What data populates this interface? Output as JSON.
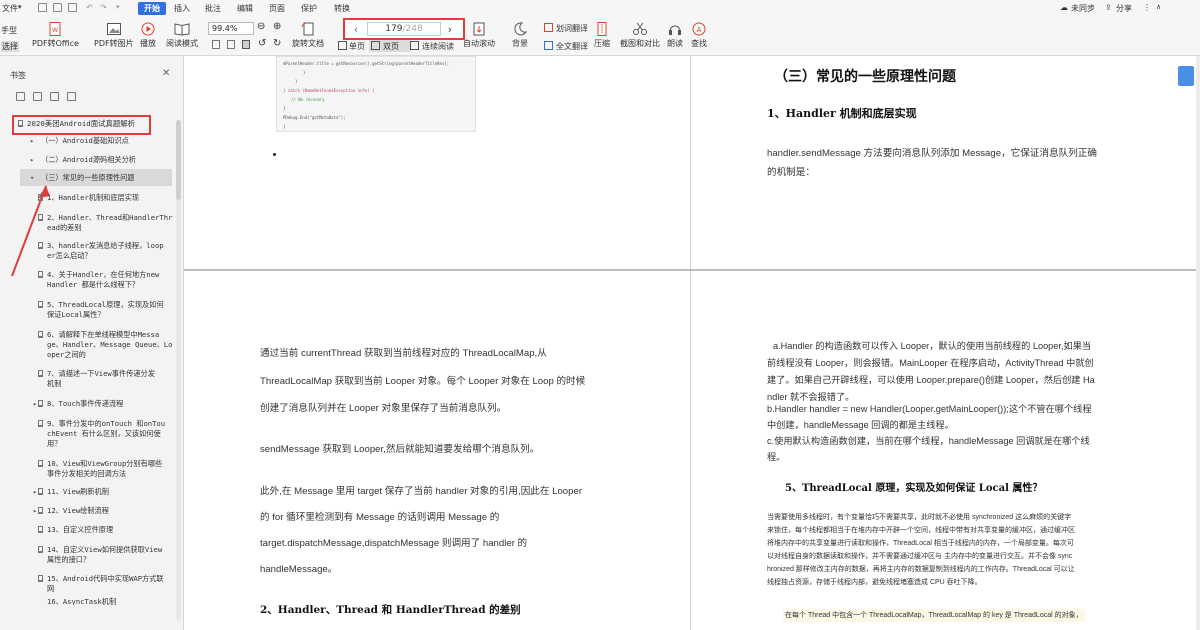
{
  "menu": {
    "file": "文件",
    "start": "开始",
    "tabs": [
      "插入",
      "批注",
      "编辑",
      "页面",
      "保护",
      "转换"
    ],
    "sync": "未同步",
    "share": "分享"
  },
  "left_tools": {
    "hand": "手型",
    "select": "选择"
  },
  "toolbar": {
    "pdf_to_office": "PDF转Office",
    "pdf_to_image": "PDF转图片",
    "play": "播放",
    "read_mode": "阅读模式",
    "zoom": "99.4%",
    "rotate_doc": "旋转文档",
    "single_page": "单页",
    "double_page": "双页",
    "continuous": "连续阅读",
    "auto_scroll": "自动滚动",
    "background": "背景",
    "word_translate": "划词翻译",
    "full_translate": "全文翻译",
    "compress": "压缩",
    "screenshot_compare": "截图和对比",
    "read_aloud": "朗读",
    "search": "查找"
  },
  "page_nav": {
    "current": "179",
    "total": "/248"
  },
  "sidebar": {
    "title": "书签",
    "root": "2020美团Android面试真题解析",
    "items": [
      {
        "label": "（一）Android基础知识点"
      },
      {
        "label": "（二）Android源码相关分析"
      },
      {
        "label": "（三）常见的一些原理性问题"
      },
      {
        "label": "1、Handler机制和底层实现"
      },
      {
        "label": "2、Handler、Thread和HandlerThr",
        "label2": "ead的差别"
      },
      {
        "label": "3、handler发消息给子线程，loop",
        "label2": "er怎么启动？"
      },
      {
        "label": "4、关于Handler，在任何地方new",
        "label2": "Handler 都是什么线程下？"
      },
      {
        "label": "5、ThreadLocal原理，实现及如何",
        "label2": "保证Local属性？"
      },
      {
        "label": "6、请解释下在单线程模型中Messa",
        "label2": "ge、Handler、Message Queue、Lo",
        "label3": "oper之间的"
      },
      {
        "label": "7、请描述一下View事件传递分发",
        "label2": "机制"
      },
      {
        "label": "8、Touch事件传递流程"
      },
      {
        "label": "9、事件分发中的onTouch 和onTou",
        "label2": "chEvent 有什么区别，又该如何使",
        "label3": "用？"
      },
      {
        "label": "10、View和ViewGroup分别有哪些",
        "label2": "事件分发相关的回调方法"
      },
      {
        "label": "11、View刷新机制"
      },
      {
        "label": "12、View绘制流程"
      },
      {
        "label": "13、自定义控件原理"
      },
      {
        "label": "14、自定义View如何提供获取View",
        "label2": "属性的接口？"
      },
      {
        "label": "15、Android代码中实现WAP方式联",
        "label2": "网"
      },
      {
        "label": "16、AsyncTask机制"
      }
    ]
  },
  "page_top_left": {
    "code_lines": [
      "mParentHeader.title = getResources().getString(parentHeaderTitleRes);",
      "}",
      "}",
      "} catch (NameNotFoundException nnfe) {",
      "// No recovery",
      "}",
      "PDebug.End(\"getMetaData\");",
      "}"
    ]
  },
  "page_top_right": {
    "heading": "（三）常见的一些原理性问题",
    "subheading": "1、Handler 机制和底层实现",
    "para1": "handler.sendMessage 方法要向消息队列添加 Message，它保证消息队列正确",
    "para2": "的机制是："
  },
  "page_bottom_left": {
    "lines": [
      "通过当前 currentThread 获取到当前线程对应的 ThreadLocalMap,从",
      "ThreadLocalMap 获取到当前 Looper 对象。每个 Looper 对象在 Loop 的时候",
      "创建了消息队列并在 Looper 对象里保存了当前消息队列。",
      "sendMessage 获取到 Looper,然后就能知道要发给哪个消息队列。",
      "此外,在 Message 里用  target 保存了当前 handler 对象的引用,因此在 Looper",
      "的 for 循环里检测到有 Message 的话则调用 Message 的",
      "target.dispatchMessage,dispatchMessage 则调用了 handler 的",
      "handleMessage。"
    ],
    "heading": "2、Handler、Thread 和 HandlerThread 的差别"
  },
  "page_bottom_right": {
    "lines": [
      "a.Handler 的构造函数可以传入 Looper，默认的使用当前线程的 Looper,如果当",
      "前线程没有 Looper，则会报错。MainLooper 在程序启动，ActivityThread 中就创",
      "建了。如果自己开辟线程，可以使用 Looper.prepare()创建 Looper，然后创建 Ha",
      "ndler 就不会报错了。",
      "b.Handler handler = new Handler(Looper.getMainLooper());这个不管在哪个线程",
      "中创建，handleMessage 回调的都是主线程。",
      "c.使用默认构造函数创建，当前在哪个线程，handleMessage 回调就是在哪个线",
      "程。"
    ],
    "heading": "5、ThreadLocal 原理，实现及如何保证 Local 属性？",
    "small_lines": [
      "当需要使用多线程时，有个变量恰巧不需要共享，此时就不必使用 synchronized 这么麻烦的关键字",
      "来锁住，每个线程都相当于在堆内存中开辟一个空间，线程中带有对共享变量的缓冲区，通过缓冲区",
      "将堆内存中的共享变量进行读取和操作，ThreadLocal 相当于线程内的内存，一个局部变量。每次可",
      "以对线程自身的数据读取和操作，并不需要通过缓冲区与 主内存中的变量进行交互。并不会像 sync",
      "hronized 那样修改主内存的数据，再将主内存的数据复制到线程内的工作内存。ThreadLocal 可以让",
      "线程独占资源，存储于线程内部，避免线程堵塞造成 CPU 吞吐下降。"
    ],
    "last_line": "在每个 Thread 中包含一个 ThreadLocalMap，ThreadLocalMap 的 key 是 ThreadLocal 的对象，"
  }
}
